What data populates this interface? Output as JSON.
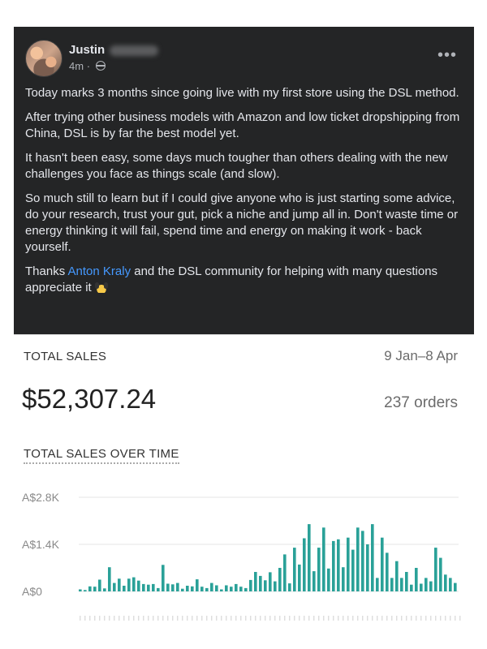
{
  "post": {
    "author": "Justin",
    "timestamp": "4m",
    "more_icon": "more-options-icon",
    "paragraphs": [
      "Today marks 3 months since going live with my first store using the DSL method.",
      "After trying other business models with Amazon and low ticket dropshipping from China, DSL is by far the best model yet.",
      "It hasn't been easy, some days much tougher than others dealing with the new challenges you face as things scale (and slow).",
      "So much still to learn but if I could give anyone who is just starting some advice, do your research, trust your gut, pick a niche and jump all in. Don't waste time or energy thinking it will fail, spend time and energy on making it work - back yourself."
    ],
    "thanks_prefix": "Thanks ",
    "thanks_link": "Anton Kraly",
    "thanks_suffix": " and the DSL community for helping with many questions appreciate it "
  },
  "stats": {
    "total_sales_label": "TOTAL SALES",
    "date_range": "9 Jan–8 Apr",
    "total_amount": "$52,307.24",
    "orders": "237 orders",
    "chart_title": "TOTAL SALES OVER TIME"
  },
  "chart_data": {
    "type": "bar",
    "title": "TOTAL SALES OVER TIME",
    "ytick_labels": [
      "A$2.8K",
      "A$1.4K",
      "A$0"
    ],
    "ylim": [
      -300,
      2800
    ],
    "grid": true,
    "bar_color": "#2aa198",
    "values": [
      60,
      40,
      150,
      140,
      350,
      90,
      720,
      250,
      380,
      170,
      380,
      420,
      320,
      220,
      200,
      220,
      100,
      790,
      230,
      210,
      250,
      80,
      170,
      150,
      360,
      140,
      100,
      250,
      180,
      60,
      180,
      140,
      220,
      140,
      100,
      340,
      580,
      460,
      330,
      570,
      300,
      700,
      1100,
      240,
      1300,
      800,
      1580,
      2000,
      600,
      1300,
      1900,
      680,
      1500,
      1550,
      720,
      1600,
      1240,
      1900,
      1800,
      1400,
      2000,
      400,
      1600,
      1150,
      400,
      900,
      400,
      580,
      200,
      700,
      230,
      400,
      300,
      1300,
      1000,
      500,
      400,
      250
    ]
  }
}
